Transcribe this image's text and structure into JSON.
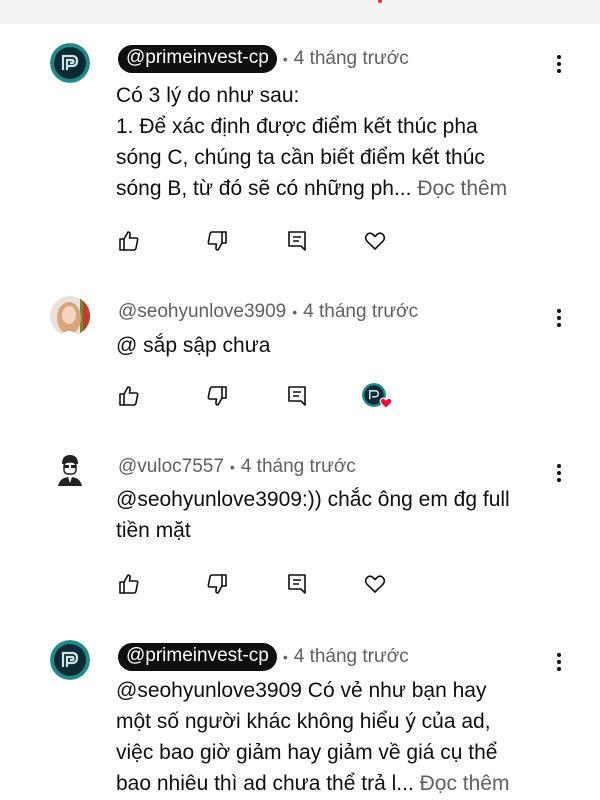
{
  "comments": [
    {
      "handle": "@primeinvest-cp",
      "creator": true,
      "time": "4 tháng trước",
      "lines": [
        "Có 3 lý do như sau:",
        "1. Để xác định được điểm kết thúc pha",
        "sóng C, chúng ta cần biết điểm kết thúc",
        "sóng B, từ đó sẽ có những ph..."
      ],
      "read_more": "Đọc thêm",
      "hearted_by_creator": false
    },
    {
      "handle": "@seohyunlove3909",
      "creator": false,
      "time": "4 tháng trước",
      "lines": [
        "@ sắp sập chưa"
      ],
      "read_more": "",
      "hearted_by_creator": true
    },
    {
      "handle": "@vuloc7557",
      "creator": false,
      "time": "4 tháng trước",
      "lines": [
        "@seohyunlove3909:)) chắc ông em đg full",
        "tiền mặt"
      ],
      "read_more": "",
      "hearted_by_creator": false
    },
    {
      "handle": "@primeinvest-cp",
      "creator": true,
      "time": "4 tháng trước",
      "lines": [
        "@seohyunlove3909 Có vẻ như bạn hay",
        "một số người khác không hiểu ý của ad,",
        "việc bao giờ giảm hay giảm về giá cụ thể",
        "bao nhiêu thì ad chưa thể trả l..."
      ],
      "read_more": "Đọc thêm",
      "hearted_by_creator": false
    }
  ],
  "separator": "•",
  "icons": {
    "like": "thumbs-up-icon",
    "dislike": "thumbs-down-icon",
    "reply": "reply-icon",
    "heart": "heart-icon",
    "more": "more-vertical-icon"
  },
  "colors": {
    "text": "#0f0f0f",
    "secondary": "#606060",
    "creator_pill": "#0f0f0f",
    "heart_red": "#ff0033",
    "top_bar": "#f2f2f2"
  }
}
